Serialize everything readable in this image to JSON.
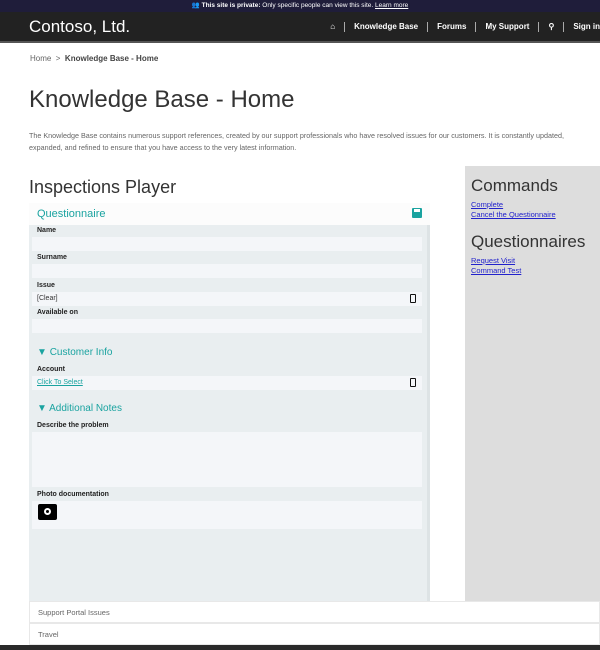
{
  "notice": {
    "bold": "This site is private:",
    "text": " Only specific people can view this site. ",
    "link": "Learn more"
  },
  "header": {
    "brand": "Contoso, Ltd.",
    "nav": [
      "Knowledge Base",
      "Forums",
      "My Support"
    ],
    "signin": "Sign in"
  },
  "breadcrumb": {
    "home": "Home",
    "sep": ">",
    "current": "Knowledge Base - Home"
  },
  "page": {
    "title": "Knowledge Base - Home",
    "description": "The Knowledge Base contains numerous support references, created by our support professionals who have resolved issues for our customers. It is constantly updated, expanded, and refined to ensure that you have access to the very latest information."
  },
  "player": {
    "title": "Inspections Player",
    "questionnaire": "Questionnaire",
    "fields": {
      "name": "Name",
      "surname": "Surname",
      "issue": "Issue",
      "issue_value": "[Clear]",
      "available": "Available on"
    },
    "customer_info": "Customer Info",
    "account": "Account",
    "account_value": "Click To Select",
    "additional_notes": "Additional Notes",
    "describe": "Describe the problem",
    "photo": "Photo documentation"
  },
  "sidebar": {
    "commands_title": "Commands",
    "commands": [
      "Complete",
      "Cancel the Questionnaire"
    ],
    "questionnaires_title": "Questionnaires",
    "questionnaires": [
      "Request Visit",
      "Command Test"
    ]
  },
  "list": [
    "Support Portal Issues",
    "Travel"
  ],
  "colors": {
    "accent": "#1aa3a0",
    "header": "#222222",
    "notice": "#1f1d3a",
    "sidebar": "#dddddd"
  }
}
